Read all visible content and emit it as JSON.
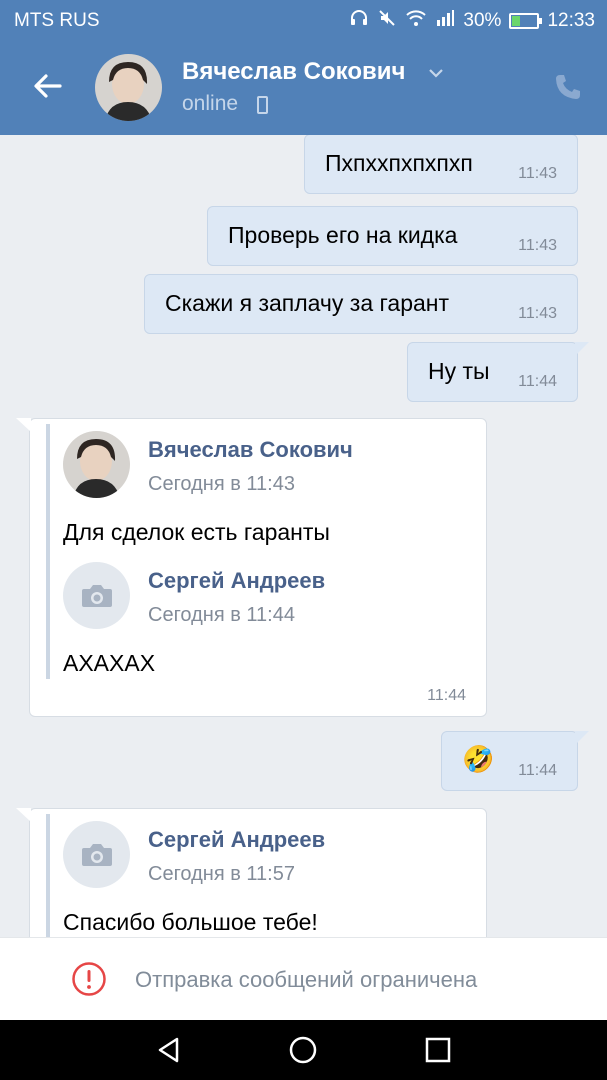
{
  "status_bar": {
    "carrier": "MTS RUS",
    "battery": "30%",
    "battery_level": 0.3,
    "time": "12:33"
  },
  "header": {
    "name": "Вячеслав Сокович",
    "status": "online"
  },
  "messages_out": [
    {
      "text": "Пхпххпхпхпхп",
      "time": "11:43"
    },
    {
      "text": "Проверь его на кидка",
      "time": "11:43"
    },
    {
      "text": "Скажи я заплачу за гарант",
      "time": "11:43"
    },
    {
      "text": "Ну ты",
      "time": "11:44"
    }
  ],
  "forward_1": {
    "author1": "Вячеслав Сокович",
    "time1": "Сегодня в 11:43",
    "text1": "Для сделок есть гаранты",
    "author2": "Сергей Андреев",
    "time2": "Сегодня в 11:44",
    "text2": "АХАХАХ",
    "time": "11:44"
  },
  "emoji_message": {
    "emoji": "🤣",
    "time": "11:44"
  },
  "forward_2": {
    "author": "Сергей Андреев",
    "time": "Сегодня в 11:57",
    "text": "Спасибо большое тебе!"
  },
  "restriction": {
    "text": "Отправка сообщений ограничена"
  },
  "colors": {
    "header": "#5181b8",
    "outgoing_bubble": "#dde8f5",
    "link_name": "#49618a",
    "alert": "#e64646"
  }
}
